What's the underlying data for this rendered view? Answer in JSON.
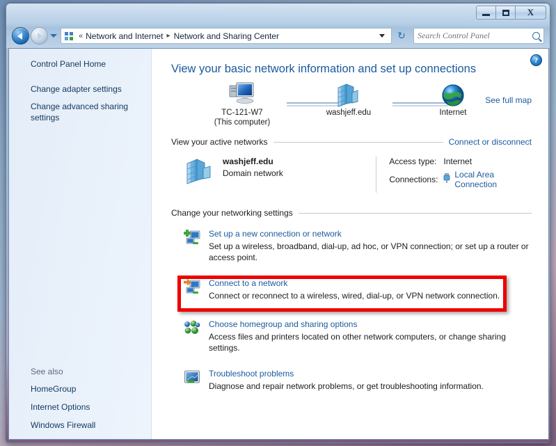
{
  "window": {
    "buttons": {
      "minimize": "minimize",
      "maximize": "maximize",
      "close": "X"
    }
  },
  "addressbar": {
    "breadcrumbs": [
      "Network and Internet",
      "Network and Sharing Center"
    ],
    "chevron": "«",
    "separator": "▸",
    "refresh_icon": "↻",
    "search": {
      "placeholder": "Search Control Panel",
      "value": ""
    }
  },
  "sidebar": {
    "top_links": [
      {
        "label": "Control Panel Home"
      },
      {
        "label": "Change adapter settings"
      },
      {
        "label": "Change advanced sharing settings"
      }
    ],
    "see_also": {
      "heading": "See also",
      "links": [
        {
          "label": "HomeGroup"
        },
        {
          "label": "Internet Options"
        },
        {
          "label": "Windows Firewall"
        }
      ]
    }
  },
  "main": {
    "help_label": "?",
    "page_title": "View your basic network information and set up connections",
    "see_full_map": "See full map",
    "netmap": {
      "nodes": [
        {
          "icon": "computer-icon",
          "label": "TC-121-W7",
          "sublabel": "(This computer)"
        },
        {
          "icon": "server-icon",
          "label": "washjeff.edu",
          "sublabel": ""
        },
        {
          "icon": "globe-icon",
          "label": "Internet",
          "sublabel": ""
        }
      ]
    },
    "active_networks": {
      "heading": "View your active networks",
      "action_link": "Connect or disconnect",
      "network": {
        "icon": "server-icon",
        "name": "washjeff.edu",
        "type": "Domain network"
      },
      "details": [
        {
          "label": "Access type:",
          "value": "Internet",
          "is_link": false
        },
        {
          "label": "Connections:",
          "value": "Local Area Connection",
          "is_link": true,
          "icon": "network-plug-icon"
        }
      ]
    },
    "settings": {
      "heading": "Change your networking settings",
      "items": [
        {
          "icon": "new-connection-icon",
          "title": "Set up a new connection or network",
          "desc": "Set up a wireless, broadband, dial-up, ad hoc, or VPN connection; or set up a router or access point.",
          "highlighted": false
        },
        {
          "icon": "connect-network-icon",
          "title": "Connect to a network",
          "desc": "Connect or reconnect to a wireless, wired, dial-up, or VPN network connection.",
          "highlighted": true
        },
        {
          "icon": "homegroup-icon",
          "title": "Choose homegroup and sharing options",
          "desc": "Access files and printers located on other network computers, or change sharing settings.",
          "highlighted": false
        },
        {
          "icon": "troubleshoot-icon",
          "title": "Troubleshoot problems",
          "desc": "Diagnose and repair network problems, or get troubleshooting information.",
          "highlighted": false
        }
      ]
    }
  },
  "colors": {
    "accent_link": "#1a5a9e",
    "highlight": "#ee0000",
    "sidebar_bg": "#e8f0fa"
  }
}
